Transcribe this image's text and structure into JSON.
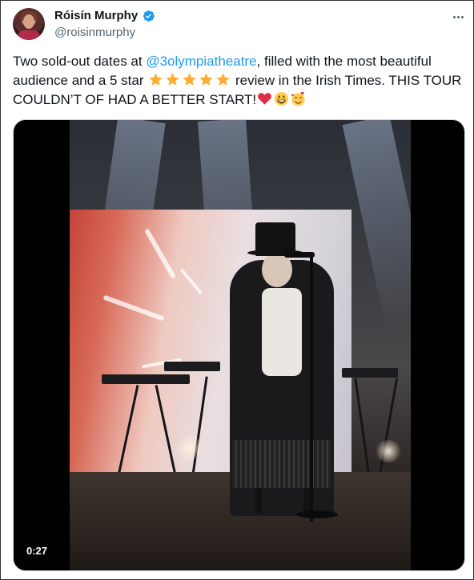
{
  "author": {
    "display_name": "Róisín Murphy",
    "handle": "@roisinmurphy",
    "verified_icon": "verified-badge-icon",
    "avatar_icon": "avatar-photo"
  },
  "tweet": {
    "text_part1": "Two sold-out dates at ",
    "mention": "@3olympiatheatre",
    "text_part2": ", filled with the most beautiful audience and a 5 star ",
    "stars_count": 5,
    "text_part3": " review in the Irish Times. THIS TOUR COULDN’T OF HAD A BETTER START!",
    "emojis": [
      "red-heart-icon",
      "grinning-face-icon",
      "smiling-face-with-hearts-icon"
    ],
    "star_icon": "star-emoji-icon"
  },
  "media": {
    "type": "video",
    "duration": "0:27"
  },
  "menu": {
    "more_icon": "more-options-icon"
  },
  "colors": {
    "link": "#1d9bf0",
    "verified": "#1d9bf0",
    "text": "#0f1419",
    "secondary": "#536471"
  }
}
